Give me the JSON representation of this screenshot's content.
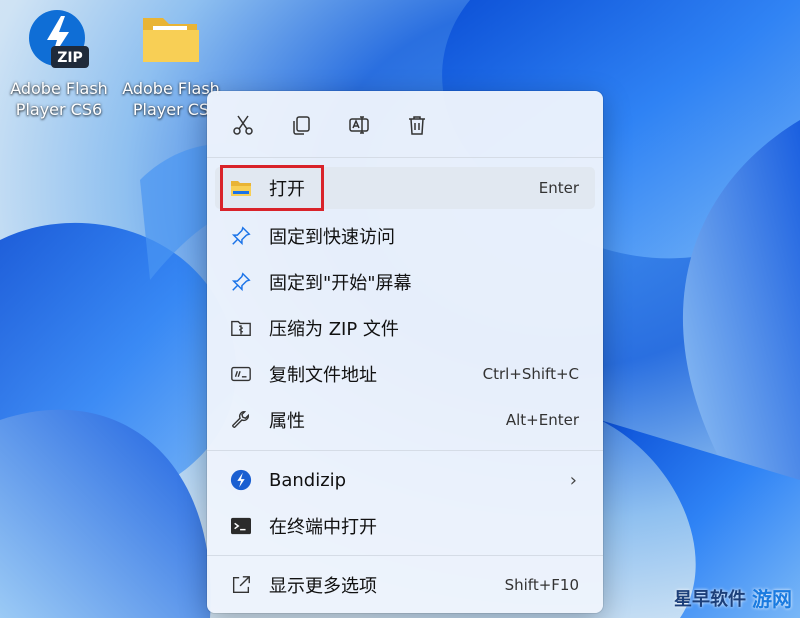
{
  "desktop": {
    "icons": [
      {
        "label": "Adobe Flash\nPlayer CS6",
        "badge": "ZIP",
        "icon": "bandizip-zip-icon"
      },
      {
        "label": "Adobe Flash\nPlayer CS",
        "icon": "folder-icon"
      }
    ]
  },
  "context_menu": {
    "toolbar": [
      "cut-icon",
      "copy-icon",
      "rename-icon",
      "delete-icon"
    ],
    "items": [
      {
        "label": "打开",
        "shortcut": "Enter",
        "icon": "folder-open-icon"
      },
      {
        "label": "固定到快速访问",
        "shortcut": "",
        "icon": "pin-icon"
      },
      {
        "label": "固定到\"开始\"屏幕",
        "shortcut": "",
        "icon": "pin-icon"
      },
      {
        "label": "压缩为 ZIP 文件",
        "shortcut": "",
        "icon": "zip-folder-icon"
      },
      {
        "label": "复制文件地址",
        "shortcut": "Ctrl+Shift+C",
        "icon": "copy-path-icon"
      },
      {
        "label": "属性",
        "shortcut": "Alt+Enter",
        "icon": "wrench-icon"
      },
      {
        "label": "Bandizip",
        "shortcut": "",
        "icon": "bandizip-icon",
        "submenu": true
      },
      {
        "label": "在终端中打开",
        "shortcut": "",
        "icon": "terminal-icon"
      },
      {
        "label": "显示更多选项",
        "shortcut": "Shift+F10",
        "icon": "share-icon"
      }
    ]
  },
  "watermark": {
    "brand": "星早软件",
    "site": "游网"
  }
}
